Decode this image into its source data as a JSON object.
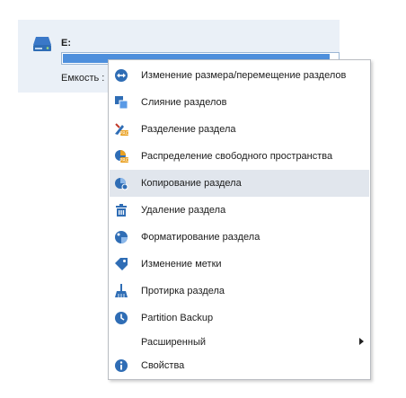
{
  "drive": {
    "letter": "E:",
    "capacity_label": "Емкость :",
    "usage_fraction": 0.97
  },
  "context_menu": {
    "items": [
      {
        "label": "Изменение размера/перемещение разделов",
        "icon": "resize-move-icon"
      },
      {
        "label": "Слияние разделов",
        "icon": "merge-partitions-icon"
      },
      {
        "label": "Разделение раздела",
        "icon": "split-partition-pro-icon"
      },
      {
        "label": "Распределение свободного пространства",
        "icon": "allocate-free-space-pro-icon"
      },
      {
        "label": "Копирование раздела",
        "icon": "copy-partition-icon"
      },
      {
        "label": "Удаление раздела",
        "icon": "trash-icon"
      },
      {
        "label": "Форматирование раздела",
        "icon": "format-partition-icon"
      },
      {
        "label": "Изменение метки",
        "icon": "tag-icon"
      },
      {
        "label": "Протирка раздела",
        "icon": "broom-icon"
      },
      {
        "label": "Partition Backup",
        "icon": "backup-clock-icon"
      },
      {
        "label": "Расширенный",
        "icon": "none"
      },
      {
        "label": "Свойства",
        "icon": "info-icon"
      }
    ],
    "highlighted_index": 4
  },
  "colors": {
    "accent": "#2f6db5",
    "bar_fill": "#4e8fdc",
    "panel_bg": "#eaf0f7",
    "highlight_bg": "#e1e6ed",
    "pro_badge": "#e9a020"
  }
}
